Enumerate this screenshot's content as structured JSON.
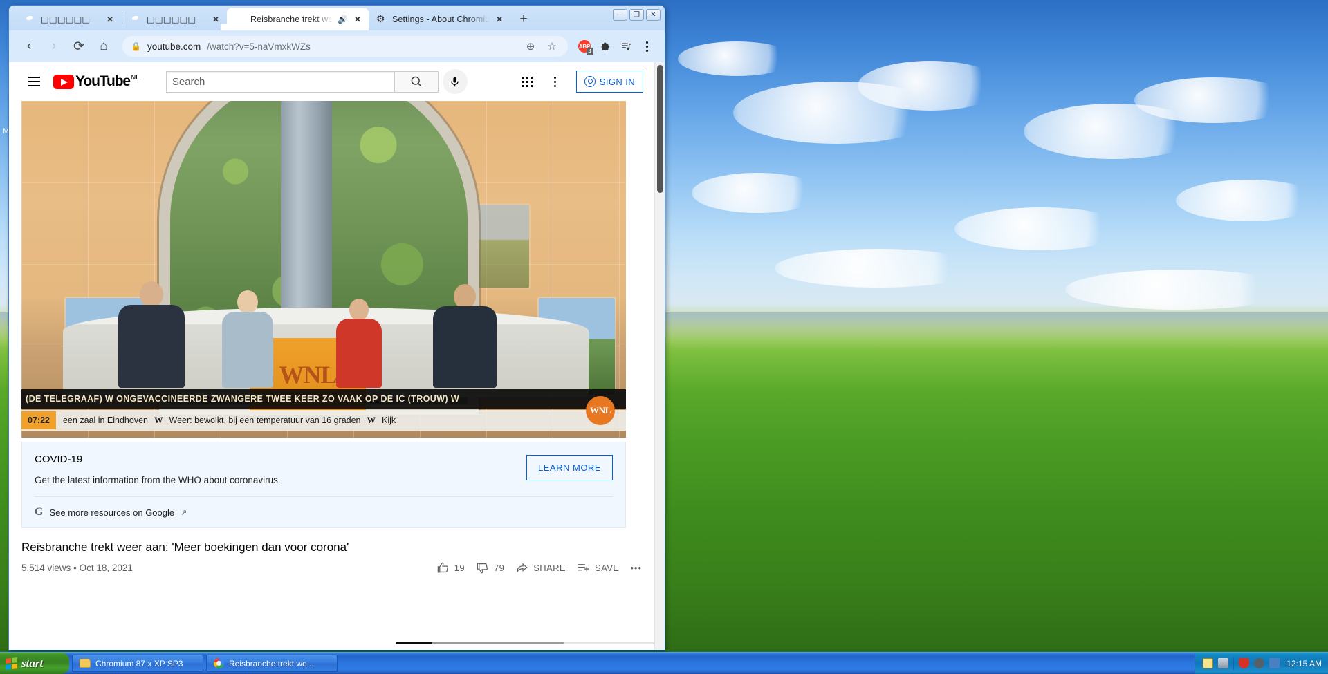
{
  "desktop": {
    "icon_label": "My Computer"
  },
  "browser": {
    "window_controls": {
      "minimize": "—",
      "maximize": "❐",
      "close": "✕"
    },
    "tabs": [
      {
        "title": "□□□□□□",
        "icon": "globe-icon",
        "active": false,
        "audio": false
      },
      {
        "title": "□□□□□□",
        "icon": "globe-icon",
        "active": false,
        "audio": false
      },
      {
        "title": "Reisbranche trekt we",
        "icon": "youtube-icon",
        "active": true,
        "audio": true
      },
      {
        "title": "Settings - About Chromium",
        "icon": "gear-icon",
        "active": false,
        "audio": false
      }
    ],
    "new_tab_label": "+",
    "toolbar": {
      "back": "‹",
      "forward": "›",
      "reload": "⟳",
      "home": "⌂",
      "url_host": "youtube.com",
      "url_path": "/watch?v=5-naVmxkWZs",
      "lock_icon": "lock-icon",
      "zoom_icon": "zoom-install-icon",
      "bookmark_icon": "star-icon",
      "abp_label": "ABP",
      "abp_badge": "4",
      "extensions_icon": "puzzle-icon",
      "media_icon": "media-playlist-icon",
      "menu_icon": "three-dot-menu-icon"
    }
  },
  "youtube": {
    "header": {
      "logo_text": "YouTube",
      "country_code": "NL",
      "search_placeholder": "Search",
      "search_value": "",
      "search_icon": "search-icon",
      "mic_icon": "microphone-icon",
      "apps_icon": "apps-grid-icon",
      "menu_icon": "three-dot-menu-icon",
      "sign_in_label": "SIGN IN"
    },
    "player": {
      "channel_bug": "WNL",
      "desk_logo": "WNL",
      "ticker_headline": "(DE TELEGRAAF)   W   ONGEVACCINEERDE ZWANGERE TWEE KEER ZO VAAK OP DE IC (TROUW)   W",
      "ticker_time": "07:22",
      "ticker_sub_1": "een zaal in Eindhoven",
      "ticker_sub_2": "Weer: bewolkt, bij een temperatuur van 16 graden",
      "ticker_sub_3": "Kijk"
    },
    "covid_panel": {
      "title": "COVID-19",
      "description": "Get the latest information from the WHO about coronavirus.",
      "learn_more_label": "LEARN MORE",
      "footer_link": "See more resources on Google",
      "footer_icon": "google-g-icon",
      "external_icon": "external-link-icon"
    },
    "video": {
      "title": "Reisbranche trekt weer aan: 'Meer boekingen dan voor corona'",
      "views": "5,514 views",
      "separator": "•",
      "date": "Oct 18, 2021",
      "like_count": "19",
      "dislike_count": "79",
      "share_label": "SHARE",
      "save_label": "SAVE",
      "more_label": "•••"
    }
  },
  "taskbar": {
    "start_label": "start",
    "items": [
      {
        "label": "Chromium 87 x XP SP3",
        "icon": "folder-icon"
      },
      {
        "label": "Reisbranche trekt we...",
        "icon": "chromium-icon"
      }
    ],
    "tray": {
      "help_icon": "help-balloon-icon",
      "network_icon": "network-icon",
      "security_icon": "security-shield-icon",
      "volume_icon": "volume-muted-icon",
      "updates_icon": "windows-update-icon",
      "time": "12:15 AM"
    }
  },
  "colors": {
    "accent_blue": "#065fd4",
    "youtube_red": "#ff0000",
    "xp_blue": "#2163cb",
    "xp_green": "#3f9228"
  }
}
